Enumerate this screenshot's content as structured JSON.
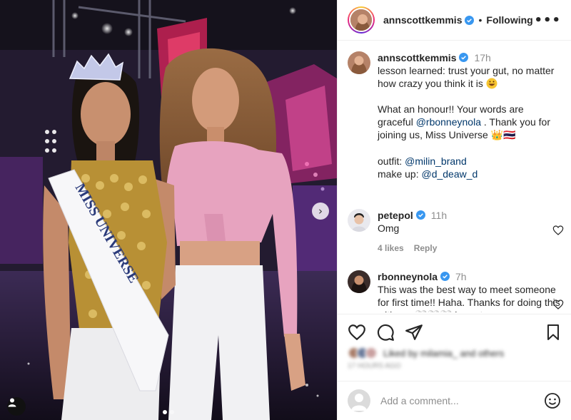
{
  "post": {
    "author": "annscottkemmis",
    "follow_status": "Following",
    "more_icon": "•••",
    "next_icon": "›"
  },
  "caption": {
    "username": "annscottkemmis",
    "time": "17h",
    "line1": "lesson learned: trust your gut, no matter how crazy you think it is",
    "line2a": "What an honour!! Your words are graceful",
    "mention1": "@rbonneynola",
    "line2b": " . Thank you for joining us, Miss Universe",
    "line2_emoji": "👑🇹🇭",
    "outfit_label": "outfit: ",
    "outfit_mention": "@milin_brand",
    "makeup_label": "make up: ",
    "makeup_mention": "@d_deaw_d"
  },
  "comments": [
    {
      "username": "petepol",
      "time": "11h",
      "text": "Omg",
      "likes": "4 likes",
      "reply": "Reply"
    },
    {
      "username": "rbonneynola",
      "time": "7h",
      "text": "This was the best way to meet someone for first time!! Haha. Thanks for doing this with me 🤍🤍🤍 hope to"
    }
  ],
  "likes_line": "Liked by milamia_ and others",
  "date_line": "17 HOURS AGO",
  "comment_input": {
    "placeholder": "Add a comment..."
  },
  "photo": {
    "sash_text": "MISS UNIVERSE"
  },
  "colors": {
    "verified": "#3897f0",
    "link": "#00376b",
    "secondary": "#8e8e8e"
  },
  "icons": [
    "heart-icon",
    "comment-icon",
    "share-icon",
    "bookmark-icon",
    "emoji-icon",
    "verified-icon",
    "user-tag-icon"
  ]
}
